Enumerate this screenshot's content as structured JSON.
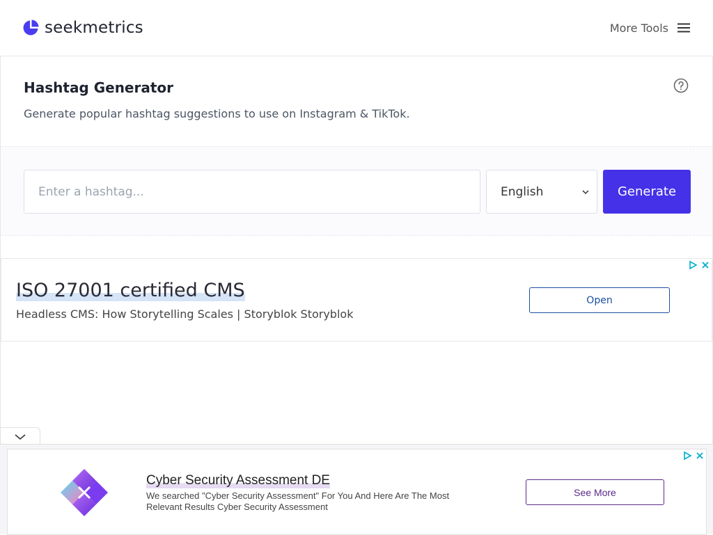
{
  "header": {
    "brand": "seekmetrics",
    "more_tools_label": "More Tools",
    "brand_color": "#4a3cf0"
  },
  "tool": {
    "title": "Hashtag Generator",
    "subtitle": "Generate popular hashtag suggestions to use on Instagram & TikTok."
  },
  "form": {
    "input_placeholder": "Enter a hashtag...",
    "input_value": "",
    "language_selected": "English",
    "generate_label": "Generate",
    "accent_color": "#4431e8"
  },
  "ad_top": {
    "headline": "ISO 27001 certified CMS",
    "description": "Headless CMS: How Storytelling Scales | Storyblok Storyblok",
    "button_label": "Open"
  },
  "ad_bottom": {
    "headline": "Cyber Security Assessment DE",
    "description": "We searched \"Cyber Security Assessment\" For You And Here Are The Most Relevant Results Cyber Security Assessment",
    "button_label": "See More"
  },
  "icons": {
    "logo": "pie-chart-icon",
    "menu": "hamburger-icon",
    "help": "question-circle-icon",
    "select_arrow": "chevron-down-icon",
    "adchoices": "adchoices-icon",
    "close": "close-icon",
    "collapse": "chevron-down-icon"
  }
}
